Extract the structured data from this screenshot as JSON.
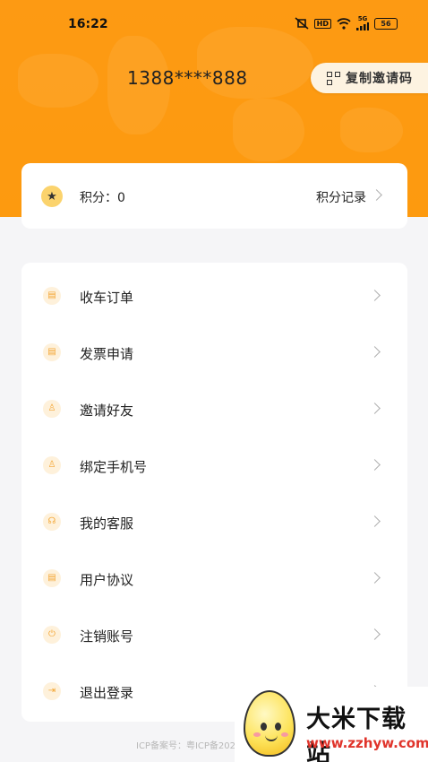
{
  "status_bar": {
    "time": "16:22",
    "hd_label": "HD",
    "signal_label": "5G",
    "battery": "56"
  },
  "profile": {
    "phone": "1388****888",
    "invite_button_label": "复制邀请码"
  },
  "points": {
    "label": "积分：0",
    "record_label": "积分记录"
  },
  "menu": [
    {
      "label": "收车订单",
      "icon": "order-icon"
    },
    {
      "label": "发票申请",
      "icon": "invoice-icon"
    },
    {
      "label": "邀请好友",
      "icon": "invite-friend-icon"
    },
    {
      "label": "绑定手机号",
      "icon": "bind-phone-icon"
    },
    {
      "label": "我的客服",
      "icon": "customer-service-icon"
    },
    {
      "label": "用户协议",
      "icon": "agreement-icon"
    },
    {
      "label": "注销账号",
      "icon": "power-icon"
    },
    {
      "label": "退出登录",
      "icon": "logout-icon"
    }
  ],
  "footer": {
    "icp": "ICP备案号：粤ICP备202"
  },
  "watermark": {
    "title": "大米下载站",
    "url": "www.zzhyw.com"
  },
  "colors": {
    "header": "#fd9a13",
    "background": "#f5f5f7",
    "icon_accent": "#f3a533"
  }
}
